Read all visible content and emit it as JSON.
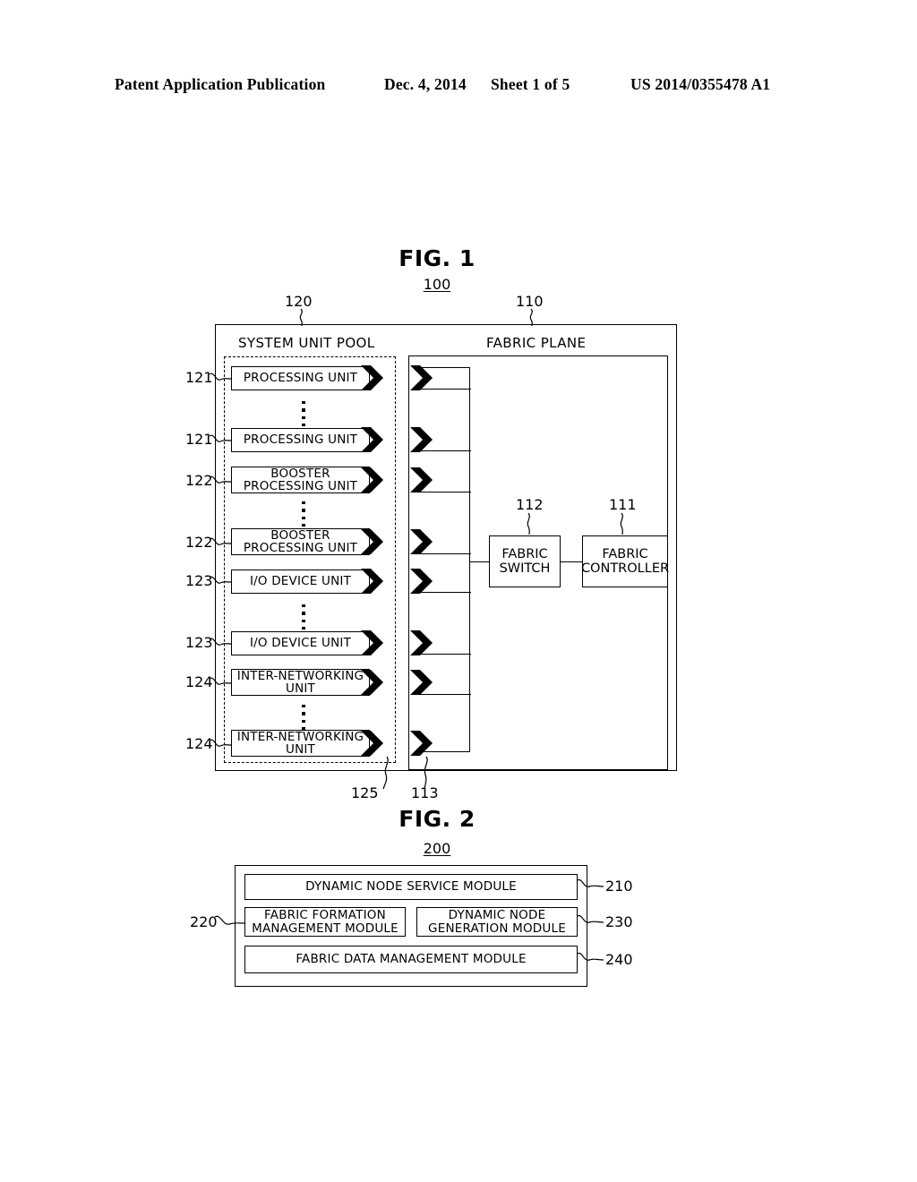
{
  "header": {
    "publication": "Patent Application Publication",
    "date": "Dec. 4, 2014",
    "sheet": "Sheet 1 of 5",
    "document_number": "US 2014/0355478 A1"
  },
  "figures": [
    {
      "title": "FIG. 1",
      "ref": "100",
      "regions": {
        "system_unit_pool": "SYSTEM UNIT POOL",
        "fabric_plane": "FABRIC PLANE"
      },
      "region_refs": {
        "system_unit_pool": "120",
        "fabric_plane": "110"
      },
      "units": [
        {
          "ref": "121",
          "label": "PROCESSING UNIT",
          "lines": [
            "PROCESSING UNIT"
          ]
        },
        {
          "ref": "121",
          "label": "PROCESSING UNIT",
          "lines": [
            "PROCESSING UNIT"
          ]
        },
        {
          "ref": "122",
          "label": "BOOSTER PROCESSING UNIT",
          "lines": [
            "BOOSTER",
            "PROCESSING UNIT"
          ]
        },
        {
          "ref": "122",
          "label": "BOOSTER PROCESSING UNIT",
          "lines": [
            "BOOSTER",
            "PROCESSING UNIT"
          ]
        },
        {
          "ref": "123",
          "label": "I/O DEVICE UNIT",
          "lines": [
            "I/O DEVICE UNIT"
          ]
        },
        {
          "ref": "123",
          "label": "I/O DEVICE UNIT",
          "lines": [
            "I/O DEVICE UNIT"
          ]
        },
        {
          "ref": "124",
          "label": "INTER-NETWORKING UNIT",
          "lines": [
            "INTER-NETWORKING",
            "UNIT"
          ]
        },
        {
          "ref": "124",
          "label": "INTER-NETWORKING UNIT",
          "lines": [
            "INTER-NETWORKING",
            "UNIT"
          ]
        }
      ],
      "blocks": [
        {
          "ref": "112",
          "label": "FABRIC SWITCH",
          "lines": [
            "FABRIC",
            "SWITCH"
          ]
        },
        {
          "ref": "111",
          "label": "FABRIC CONTROLLER",
          "lines": [
            "FABRIC",
            "CONTROLLER"
          ]
        }
      ],
      "connector_refs": {
        "system_unit_connector": "125",
        "fabric_plane_connector": "113"
      }
    },
    {
      "title": "FIG. 2",
      "ref": "200",
      "modules": [
        {
          "ref": "210",
          "label": "DYNAMIC NODE SERVICE MODULE",
          "lines": [
            "DYNAMIC NODE SERVICE MODULE"
          ]
        },
        {
          "ref": "220",
          "label": "FABRIC FORMATION MANAGEMENT MODULE",
          "lines": [
            "FABRIC FORMATION",
            "MANAGEMENT MODULE"
          ]
        },
        {
          "ref": "230",
          "label": "DYNAMIC NODE GENERATION MODULE",
          "lines": [
            "DYNAMIC NODE",
            "GENERATION MODULE"
          ]
        },
        {
          "ref": "240",
          "label": "FABRIC DATA MANAGEMENT MODULE",
          "lines": [
            "FABRIC DATA MANAGEMENT MODULE"
          ]
        }
      ]
    }
  ],
  "colors": {
    "ink": "#000000",
    "paper": "#ffffff"
  }
}
